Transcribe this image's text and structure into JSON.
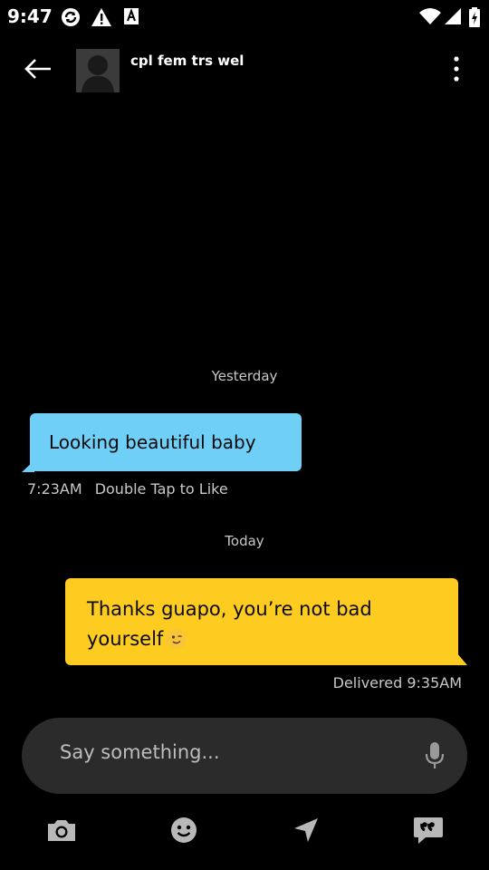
{
  "status_bar": {
    "time": "9:47"
  },
  "header": {
    "contact_name": "cpl fem trs wel"
  },
  "conversation": {
    "yesterday_label": "Yesterday",
    "today_label": "Today",
    "incoming": {
      "text": "Looking beautiful baby",
      "time": "7:23AM",
      "like_hint": "Double Tap to Like"
    },
    "outgoing": {
      "text": "Thanks guapo, you’re not bad yourself",
      "status": "Delivered 9:35AM"
    }
  },
  "composer": {
    "placeholder": "Say something..."
  },
  "toolbar": {
    "items": [
      "camera-icon",
      "emoji-icon",
      "location-icon",
      "quote-icon"
    ]
  },
  "colors": {
    "incoming_bubble": "#6fcff6",
    "outgoing_bubble": "#fecb21",
    "composer_bg": "#2b2b2b",
    "background": "#000000"
  }
}
